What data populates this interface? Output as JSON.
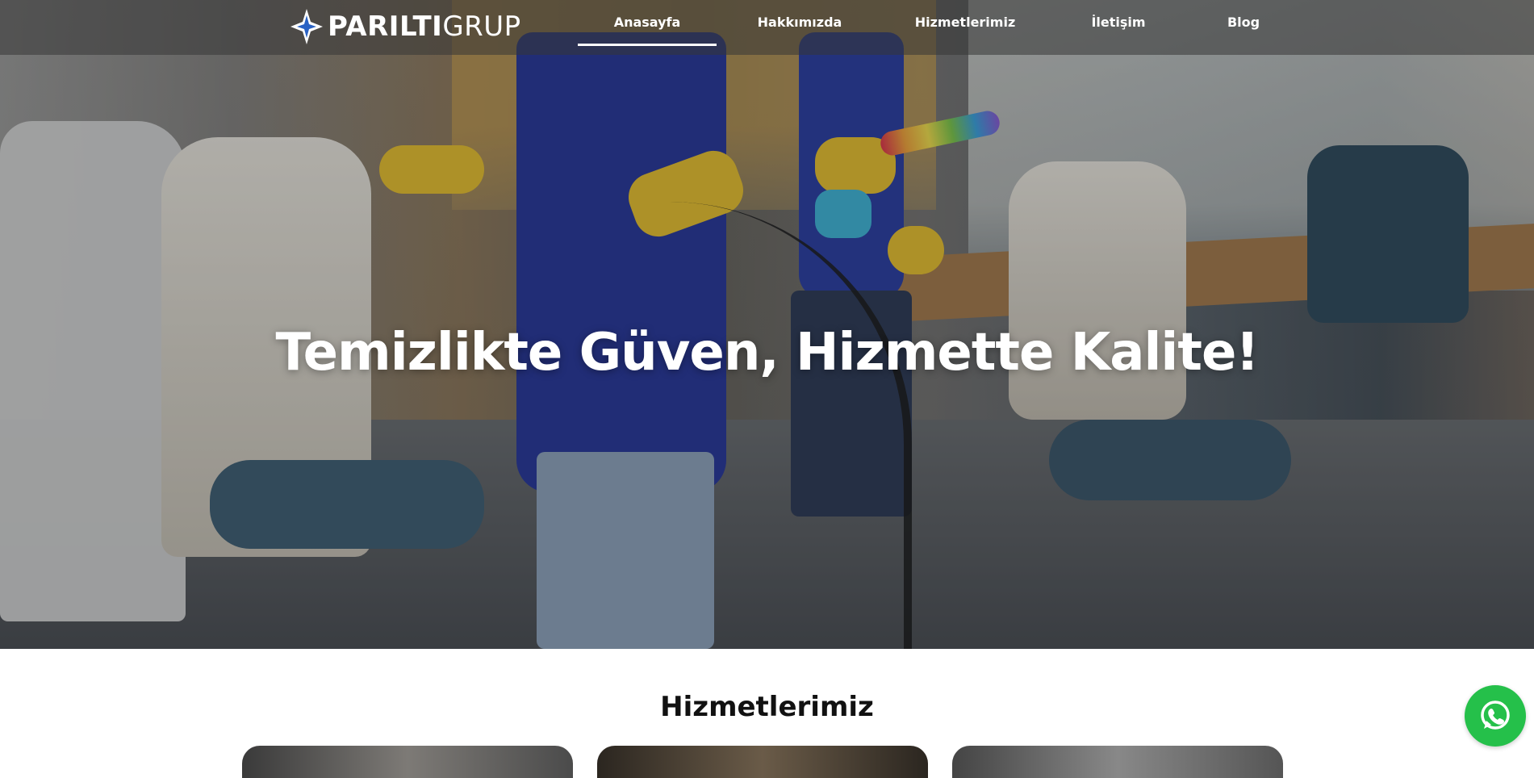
{
  "brand": {
    "logo_mark": "PG",
    "name_bold": "PARILTI",
    "name_light": "GRUP"
  },
  "nav": {
    "items": [
      {
        "label": "Anasayfa",
        "active": true
      },
      {
        "label": "Hakkımızda",
        "active": false
      },
      {
        "label": "Hizmetlerimiz",
        "active": false
      },
      {
        "label": "İletişim",
        "active": false
      },
      {
        "label": "Blog",
        "active": false
      }
    ]
  },
  "hero": {
    "title": "Temizlikte Güven, Hizmette Kalite!"
  },
  "services": {
    "title": "Hizmetlerimiz",
    "cards": 3
  },
  "icons": {
    "whatsapp": "whatsapp-icon",
    "logo": "star-logo-icon"
  },
  "colors": {
    "whatsapp": "#25c04a",
    "nav_bg": "rgba(55,55,55,0.55)",
    "text": "#111111"
  }
}
